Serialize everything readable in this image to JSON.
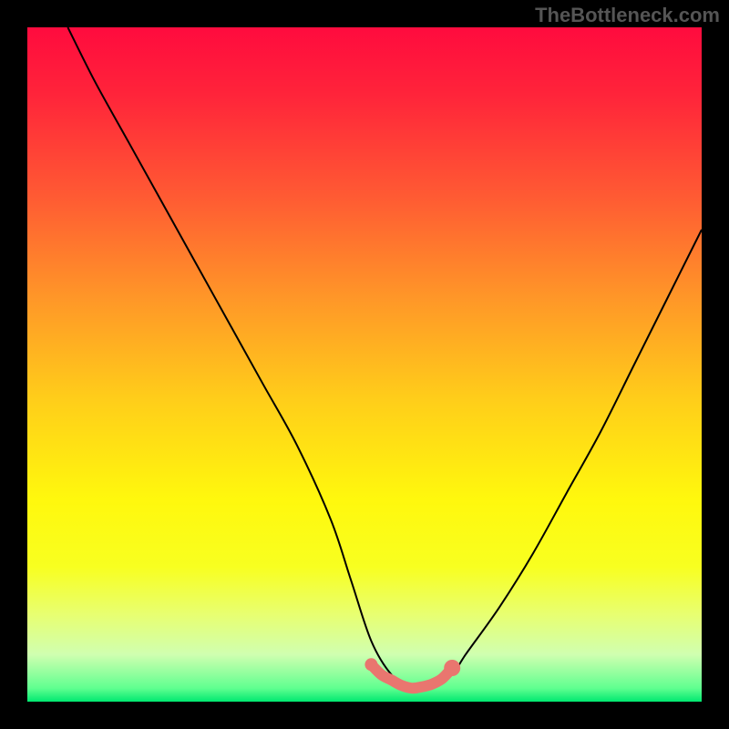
{
  "watermark": "TheBottleneck.com",
  "gradient": {
    "stops": [
      {
        "offset": 0.0,
        "color": "#ff0b3e"
      },
      {
        "offset": 0.1,
        "color": "#ff243a"
      },
      {
        "offset": 0.25,
        "color": "#ff5a33"
      },
      {
        "offset": 0.4,
        "color": "#ff9628"
      },
      {
        "offset": 0.55,
        "color": "#ffcd1a"
      },
      {
        "offset": 0.7,
        "color": "#fff80d"
      },
      {
        "offset": 0.8,
        "color": "#f8ff20"
      },
      {
        "offset": 0.87,
        "color": "#e8ff70"
      },
      {
        "offset": 0.93,
        "color": "#d0ffb0"
      },
      {
        "offset": 0.98,
        "color": "#60ff90"
      },
      {
        "offset": 1.0,
        "color": "#00e870"
      }
    ]
  },
  "chart_data": {
    "type": "line",
    "title": "",
    "xlabel": "",
    "ylabel": "",
    "xlim": [
      0,
      100
    ],
    "ylim": [
      0,
      100
    ],
    "series": [
      {
        "name": "bottleneck-curve",
        "x": [
          6,
          10,
          15,
          20,
          25,
          30,
          35,
          40,
          45,
          48,
          51,
          54,
          57,
          60,
          63,
          65,
          70,
          75,
          80,
          85,
          90,
          95,
          100
        ],
        "y": [
          100,
          92,
          83,
          74,
          65,
          56,
          47,
          38,
          27,
          18,
          9,
          4,
          2,
          2,
          4,
          7,
          14,
          22,
          31,
          40,
          50,
          60,
          70
        ]
      }
    ],
    "highlight": {
      "name": "optimum-band",
      "color": "#e9766f",
      "x": [
        51,
        52.5,
        54,
        55.5,
        57,
        58.5,
        60,
        61.5,
        63
      ],
      "y": [
        5.5,
        4.0,
        3.2,
        2.4,
        2.0,
        2.2,
        2.6,
        3.4,
        5.0
      ]
    }
  }
}
